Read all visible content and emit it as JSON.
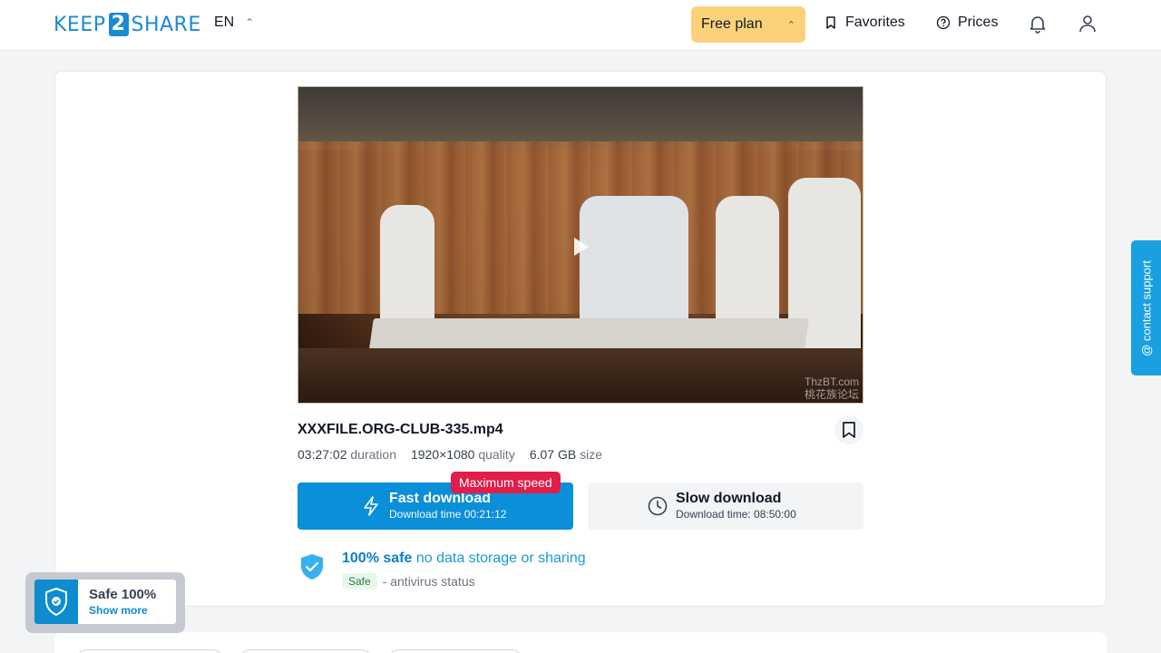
{
  "header": {
    "logo_left": "KEEP",
    "logo_num": "2",
    "logo_right": "SHARE",
    "language": "EN",
    "plan_label": "Free plan",
    "favorites_label": "Favorites",
    "prices_label": "Prices"
  },
  "file": {
    "name": "XXXFILE.ORG-CLUB-335.mp4",
    "duration_value": "03:27:02",
    "duration_label": "duration",
    "quality_value": "1920×1080",
    "quality_label": "quality",
    "size_value": "6.07 GB",
    "size_label": "size",
    "watermark_line1": "ThzBT.com",
    "watermark_line2": "桃花族论坛"
  },
  "download": {
    "fast_title": "Fast download",
    "fast_time": "Download time 00:21:12",
    "fast_badge": "Maximum speed",
    "slow_title": "Slow download",
    "slow_time": "Download time: 08:50:00"
  },
  "safety": {
    "headline_bold": "100% safe",
    "headline_rest": "no data storage or sharing",
    "pill": "Safe",
    "status_text": "- antivirus status"
  },
  "widget": {
    "title": "Safe 100%",
    "link": "Show more"
  },
  "contact_support": "@ contact support",
  "colors": {
    "brand_blue": "#0b8fd9",
    "plan_yellow": "#fbd27a",
    "badge_red": "#e11d48"
  }
}
